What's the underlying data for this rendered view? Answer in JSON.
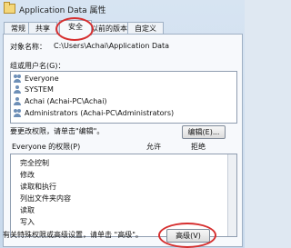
{
  "window": {
    "title": "Application Data 属性"
  },
  "tabs": [
    {
      "label": "常规"
    },
    {
      "label": "共享"
    },
    {
      "label": "安全"
    },
    {
      "label": "以前的版本"
    },
    {
      "label": "自定义"
    }
  ],
  "security": {
    "object_label": "对象名称：",
    "object_value": "C:\\Users\\Achai\\Application Data",
    "group_label": "组或用户名(G)：",
    "users": [
      {
        "label": "Everyone"
      },
      {
        "label": "SYSTEM"
      },
      {
        "label": "Achai (Achai-PC\\Achai)"
      },
      {
        "label": "Administrators (Achai-PC\\Administrators)"
      }
    ],
    "change_text": "要更改权限，请单击\"编辑\"。",
    "edit_button": "编辑(E)...",
    "perm_header": "Everyone 的权限(P)",
    "allow_header": "允许",
    "deny_header": "拒绝",
    "permissions": [
      {
        "label": "完全控制"
      },
      {
        "label": "修改"
      },
      {
        "label": "读取和执行"
      },
      {
        "label": "列出文件夹内容"
      },
      {
        "label": "读取"
      },
      {
        "label": "写入"
      }
    ],
    "special_text": "有关特殊权限或高级设置，请单击 \"高级\"。",
    "advanced_button": "高级(V)"
  },
  "highlight_color": "#d62f2f"
}
